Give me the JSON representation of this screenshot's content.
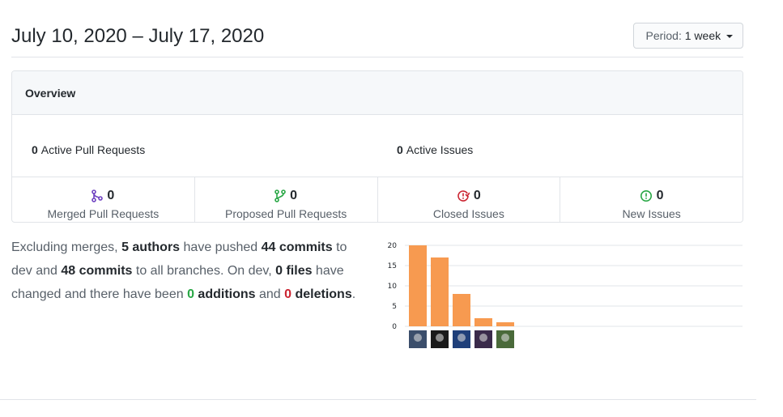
{
  "header": {
    "date_range": "July 10, 2020 – July 17, 2020",
    "period_label": "Period:",
    "period_value": "1 week"
  },
  "overview": {
    "title": "Overview",
    "active_prs": {
      "count": "0",
      "label": "Active Pull Requests"
    },
    "active_issues": {
      "count": "0",
      "label": "Active Issues"
    },
    "stats": [
      {
        "count": "0",
        "label": "Merged Pull Requests",
        "icon": "git-merge-icon",
        "color": "#6f42c1"
      },
      {
        "count": "0",
        "label": "Proposed Pull Requests",
        "icon": "git-pull-request-icon",
        "color": "#28a745"
      },
      {
        "count": "0",
        "label": "Closed Issues",
        "icon": "issue-closed-icon",
        "color": "#cb2431"
      },
      {
        "count": "0",
        "label": "New Issues",
        "icon": "issue-opened-icon",
        "color": "#28a745"
      }
    ]
  },
  "summary": {
    "t1": "Excluding merges, ",
    "authors": "5 authors",
    "t2": " have pushed ",
    "commits_dev": "44 commits",
    "t3": " to dev and ",
    "commits_all": "48 commits",
    "t4": " to all branches. On dev, ",
    "files": "0 files",
    "t5": " have changed and there have been ",
    "additions_num": "0",
    "additions_word": " additions",
    "t6": " and ",
    "deletions_num": "0",
    "deletions_word": " deletions",
    "t7": "."
  },
  "chart_data": {
    "type": "bar",
    "categories": [
      "author-1",
      "author-2",
      "author-3",
      "author-4",
      "author-5"
    ],
    "values": [
      20,
      17,
      8,
      2,
      1
    ],
    "yticks": [
      0,
      5,
      10,
      15,
      20
    ],
    "ylim": [
      0,
      20
    ],
    "bar_color": "#f79a50",
    "grid": true,
    "xlabel": "",
    "ylabel": ""
  }
}
